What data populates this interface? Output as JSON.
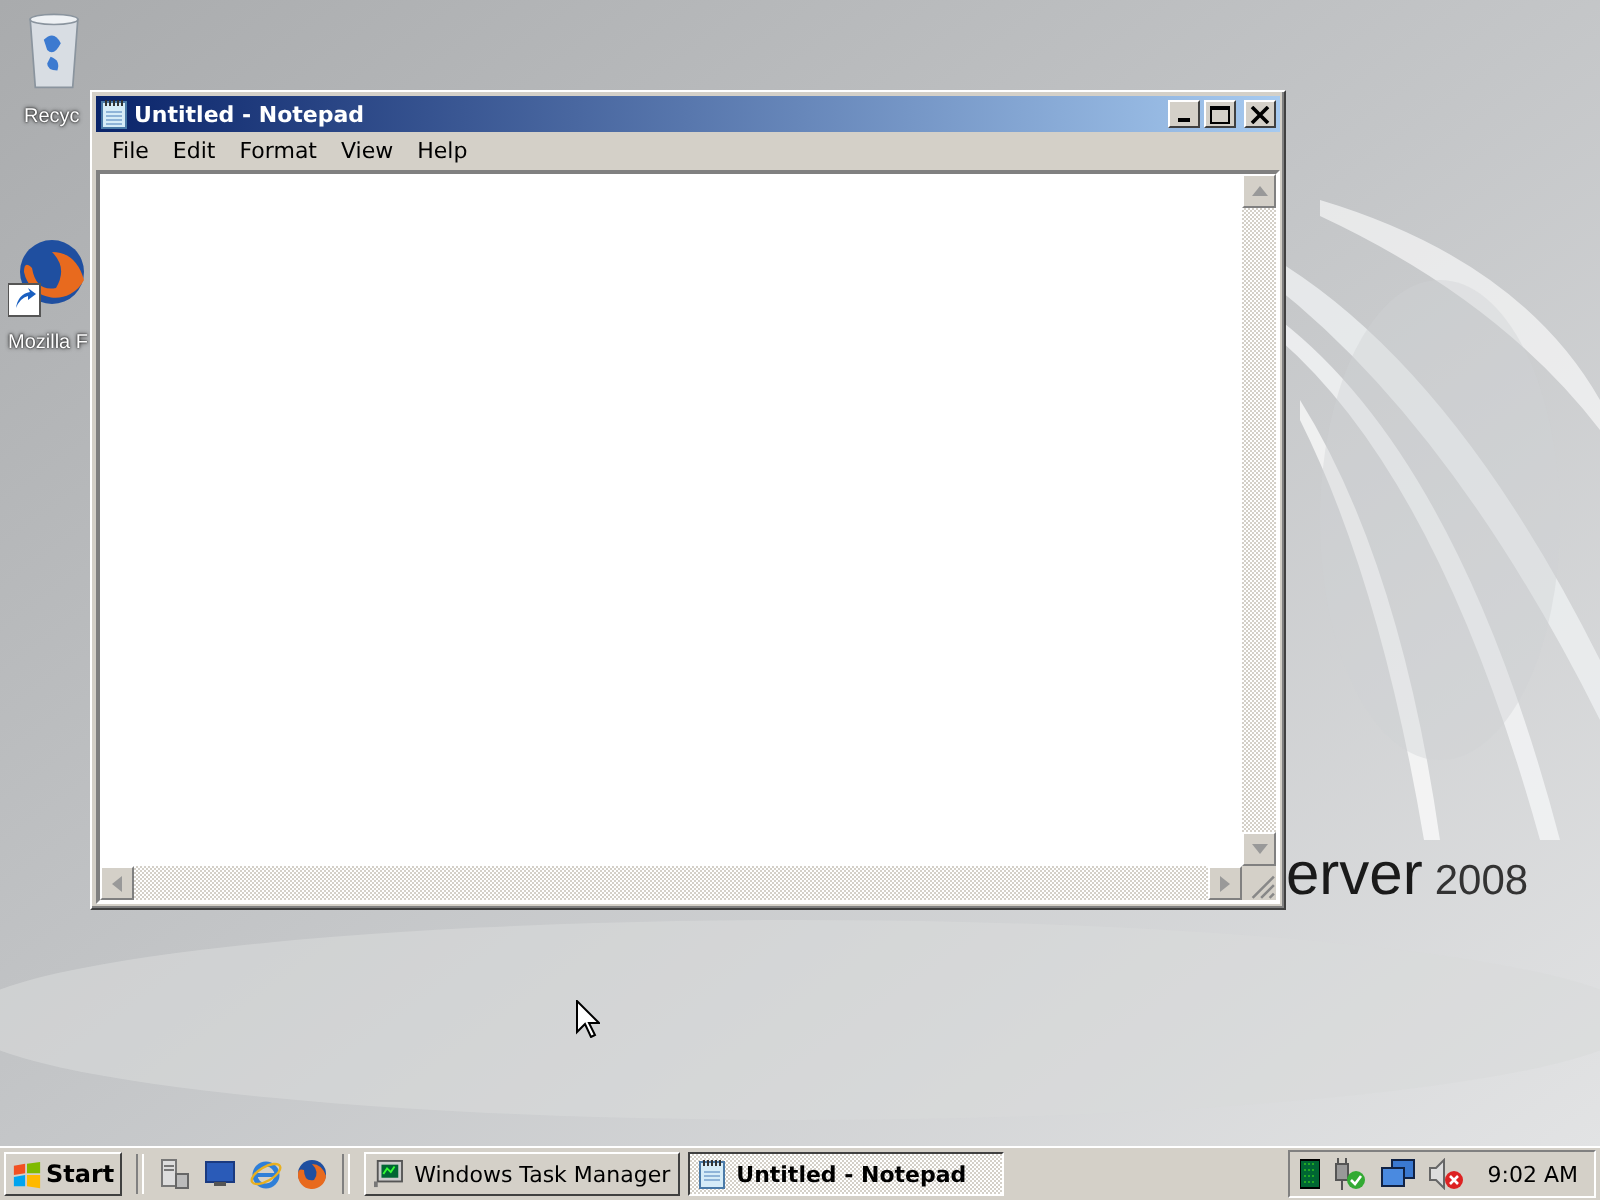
{
  "desktop_icons": [
    {
      "label": "Recyc",
      "kind": "recycle"
    },
    {
      "label": "Mozilla F",
      "kind": "firefox"
    }
  ],
  "wallpaper_text": {
    "product": "erver",
    "version": "2008"
  },
  "window": {
    "title": "Untitled - Notepad",
    "menu": [
      "File",
      "Edit",
      "Format",
      "View",
      "Help"
    ]
  },
  "taskbar": {
    "start": "Start",
    "tasks": [
      {
        "label": "Windows Task Manager",
        "kind": "taskmgr",
        "selected": false
      },
      {
        "label": "Untitled - Notepad",
        "kind": "notepad",
        "selected": true
      }
    ],
    "clock": "9:02 AM"
  }
}
